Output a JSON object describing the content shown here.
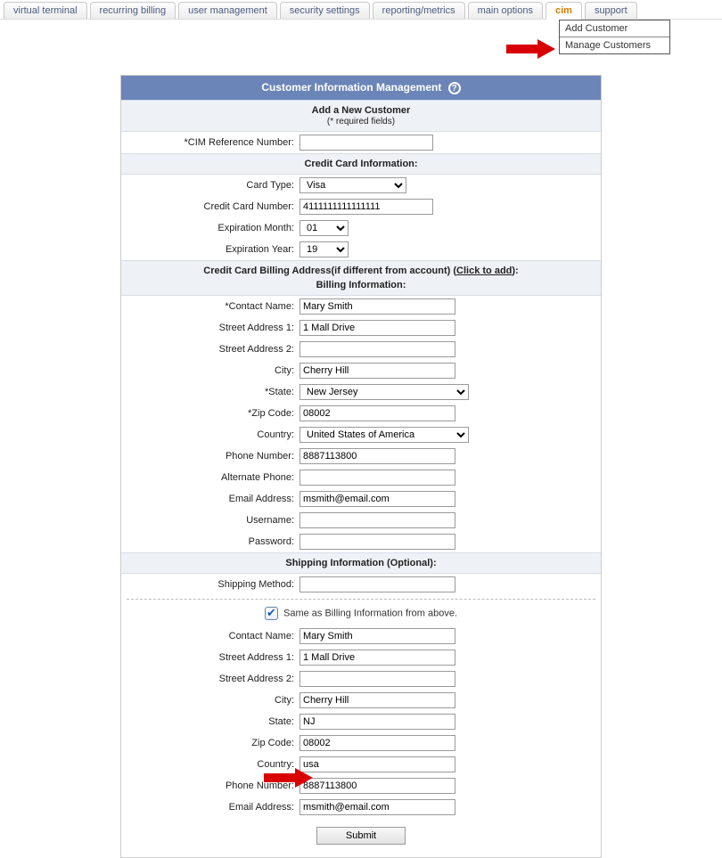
{
  "tabs": {
    "virtual_terminal": "virtual terminal",
    "recurring_billing": "recurring billing",
    "user_management": "user management",
    "security_settings": "security settings",
    "reporting_metrics": "reporting/metrics",
    "main_options": "main options",
    "cim": "cim",
    "support": "support"
  },
  "dropdown": {
    "add_customer": "Add Customer",
    "manage_customers": "Manage Customers"
  },
  "banner": "Customer Information Management",
  "help_glyph": "?",
  "sections": {
    "add_new": "Add a New Customer",
    "required_note": "(* required fields)",
    "credit_card": "Credit Card Information:",
    "cc_billing_prefix": "Credit Card Billing Address(if different from account) (",
    "cc_billing_link": "Click to add",
    "cc_billing_suffix": "):",
    "billing_info": "Billing Information:",
    "shipping_info": "Shipping Information (Optional):"
  },
  "labels": {
    "cim_ref": "*CIM Reference Number:",
    "card_type": "Card Type:",
    "cc_number": "Credit Card Number:",
    "exp_month": "Expiration Month:",
    "exp_year": "Expiration Year:",
    "contact_name_req": "*Contact Name:",
    "contact_name": "Contact Name:",
    "addr1": "Street Address 1:",
    "addr2": "Street Address 2:",
    "city": "City:",
    "state_req": "*State:",
    "state": "State:",
    "zip_req": "*Zip Code:",
    "zip": "Zip Code:",
    "country": "Country:",
    "phone": "Phone Number:",
    "alt_phone": "Alternate Phone:",
    "email": "Email Address:",
    "username": "Username:",
    "password": "Password:",
    "shipping_method": "Shipping Method:"
  },
  "values": {
    "cim_ref": "",
    "card_type": "Visa",
    "cc_number": "4111111111111111",
    "exp_month": "01",
    "exp_year": "19",
    "b_contact": "Mary Smith",
    "b_addr1": "1 Mall Drive",
    "b_addr2": "",
    "b_city": "Cherry Hill",
    "b_state": "New Jersey",
    "b_zip": "08002",
    "b_country": "United States of America",
    "b_phone": "8887113800",
    "b_alt_phone": "",
    "b_email": "msmith@email.com",
    "b_username": "",
    "b_password": "",
    "shipping_method": "",
    "s_contact": "Mary Smith",
    "s_addr1": "1 Mall Drive",
    "s_addr2": "",
    "s_city": "Cherry Hill",
    "s_state": "NJ",
    "s_zip": "08002",
    "s_country": "usa",
    "s_phone": "8887113800",
    "s_email": "msmith@email.com"
  },
  "same_as_label": "Same as Billing Information from above.",
  "submit_label": "Submit"
}
